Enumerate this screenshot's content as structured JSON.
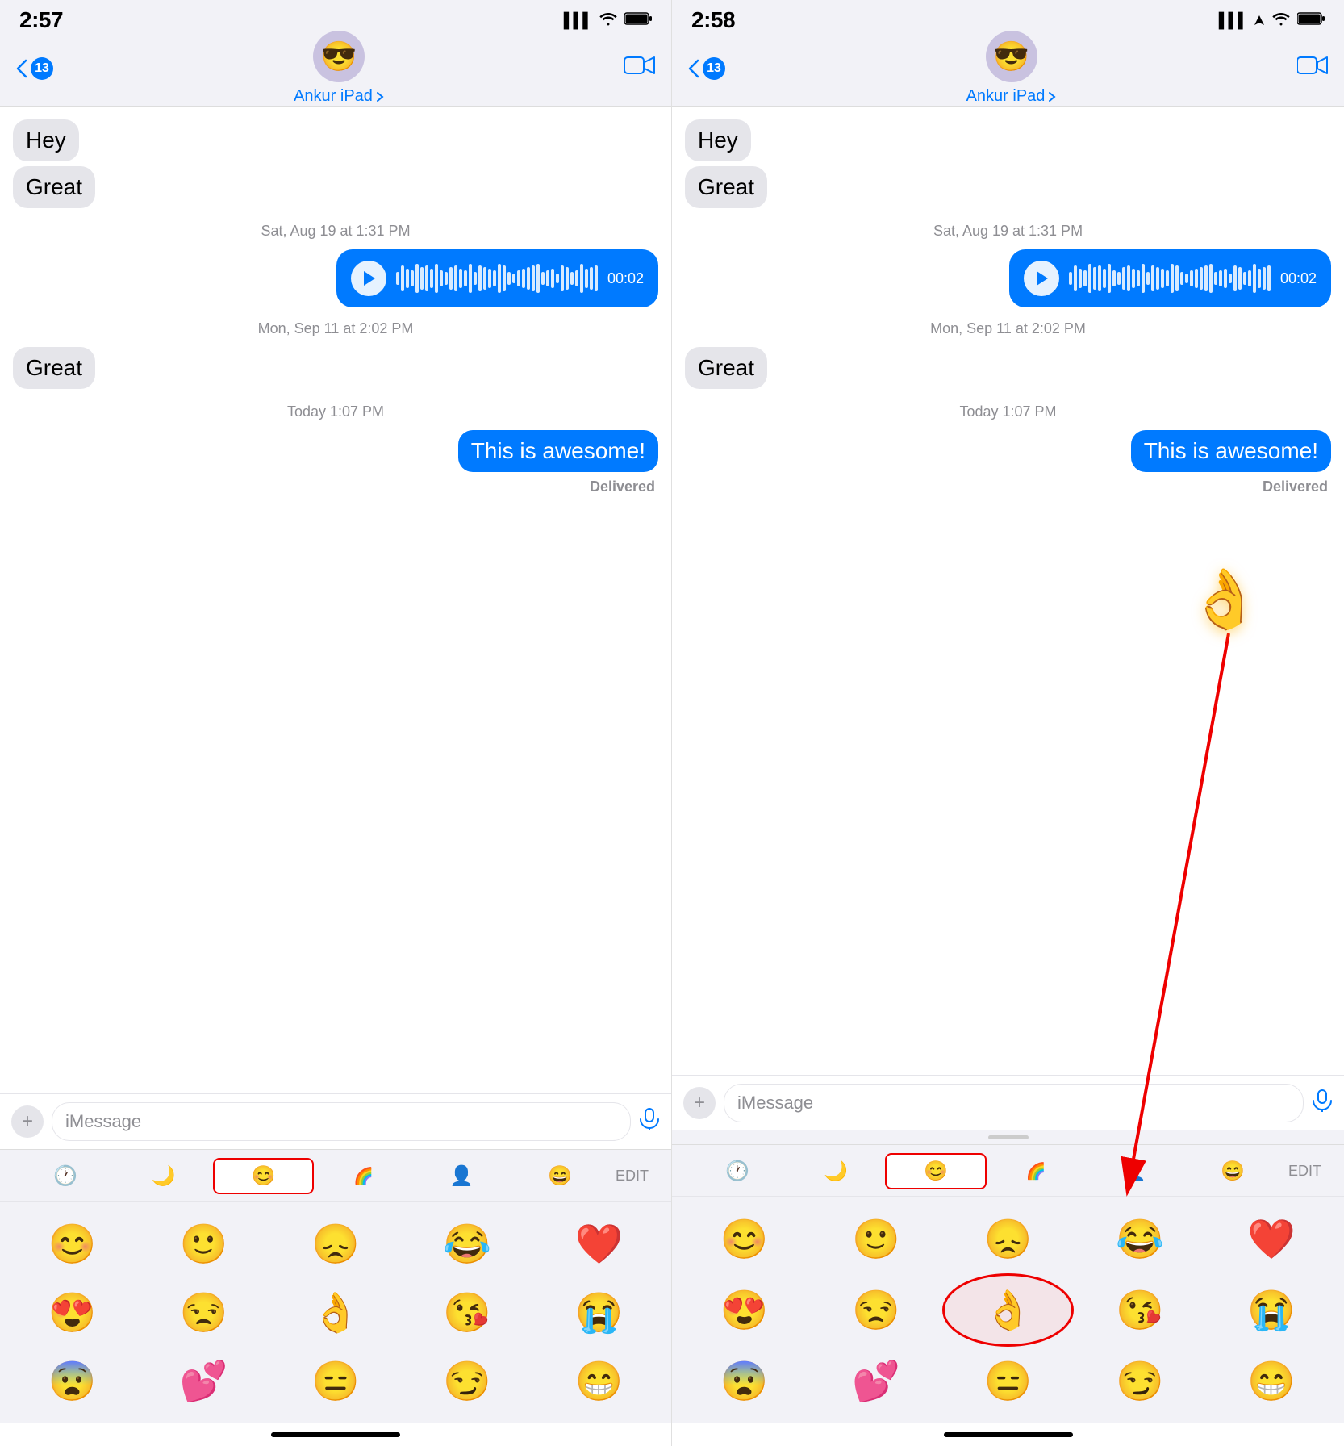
{
  "left": {
    "status_time": "2:57",
    "contact_name": "Ankur iPad",
    "badge_count": "13",
    "messages": [
      {
        "type": "received",
        "text": "Hey"
      },
      {
        "type": "received",
        "text": "Great"
      }
    ],
    "timestamp1": "Sat, Aug 19 at 1:31 PM",
    "audio_duration": "00:02",
    "timestamp2": "Mon, Sep 11 at 2:02 PM",
    "message_great": "Great",
    "timestamp3": "Today 1:07 PM",
    "sent_text": "This is awesome!",
    "delivered": "Delivered",
    "input_placeholder": "iMessage",
    "edit_label": "EDIT",
    "emoji_rows": [
      [
        "😊",
        "😊",
        "😞",
        "😂",
        "❤️"
      ],
      [
        "😍",
        "😒",
        "👌",
        "😘",
        "😭"
      ],
      [
        "😨",
        "💕",
        "😑",
        "😏",
        "😁"
      ]
    ]
  },
  "right": {
    "status_time": "2:58",
    "contact_name": "Ankur iPad",
    "badge_count": "13",
    "messages": [
      {
        "type": "received",
        "text": "Hey"
      },
      {
        "type": "received",
        "text": "Great"
      }
    ],
    "timestamp1": "Sat, Aug 19 at 1:31 PM",
    "audio_duration": "00:02",
    "timestamp2": "Mon, Sep 11 at 2:02 PM",
    "message_great": "Great",
    "timestamp3": "Today 1:07 PM",
    "sent_text": "This is awesome!",
    "delivered": "Delivered",
    "input_placeholder": "iMessage",
    "edit_label": "EDIT",
    "emoji_rows": [
      [
        "😊",
        "😊",
        "😞",
        "😂",
        "❤️"
      ],
      [
        "😍",
        "😒",
        "👌",
        "😘",
        "😭"
      ],
      [
        "😨",
        "💕",
        "😑",
        "😏",
        "😁"
      ]
    ],
    "floating_emoji": "👌",
    "arrow_annotation": true,
    "circle_emoji": "👌"
  }
}
